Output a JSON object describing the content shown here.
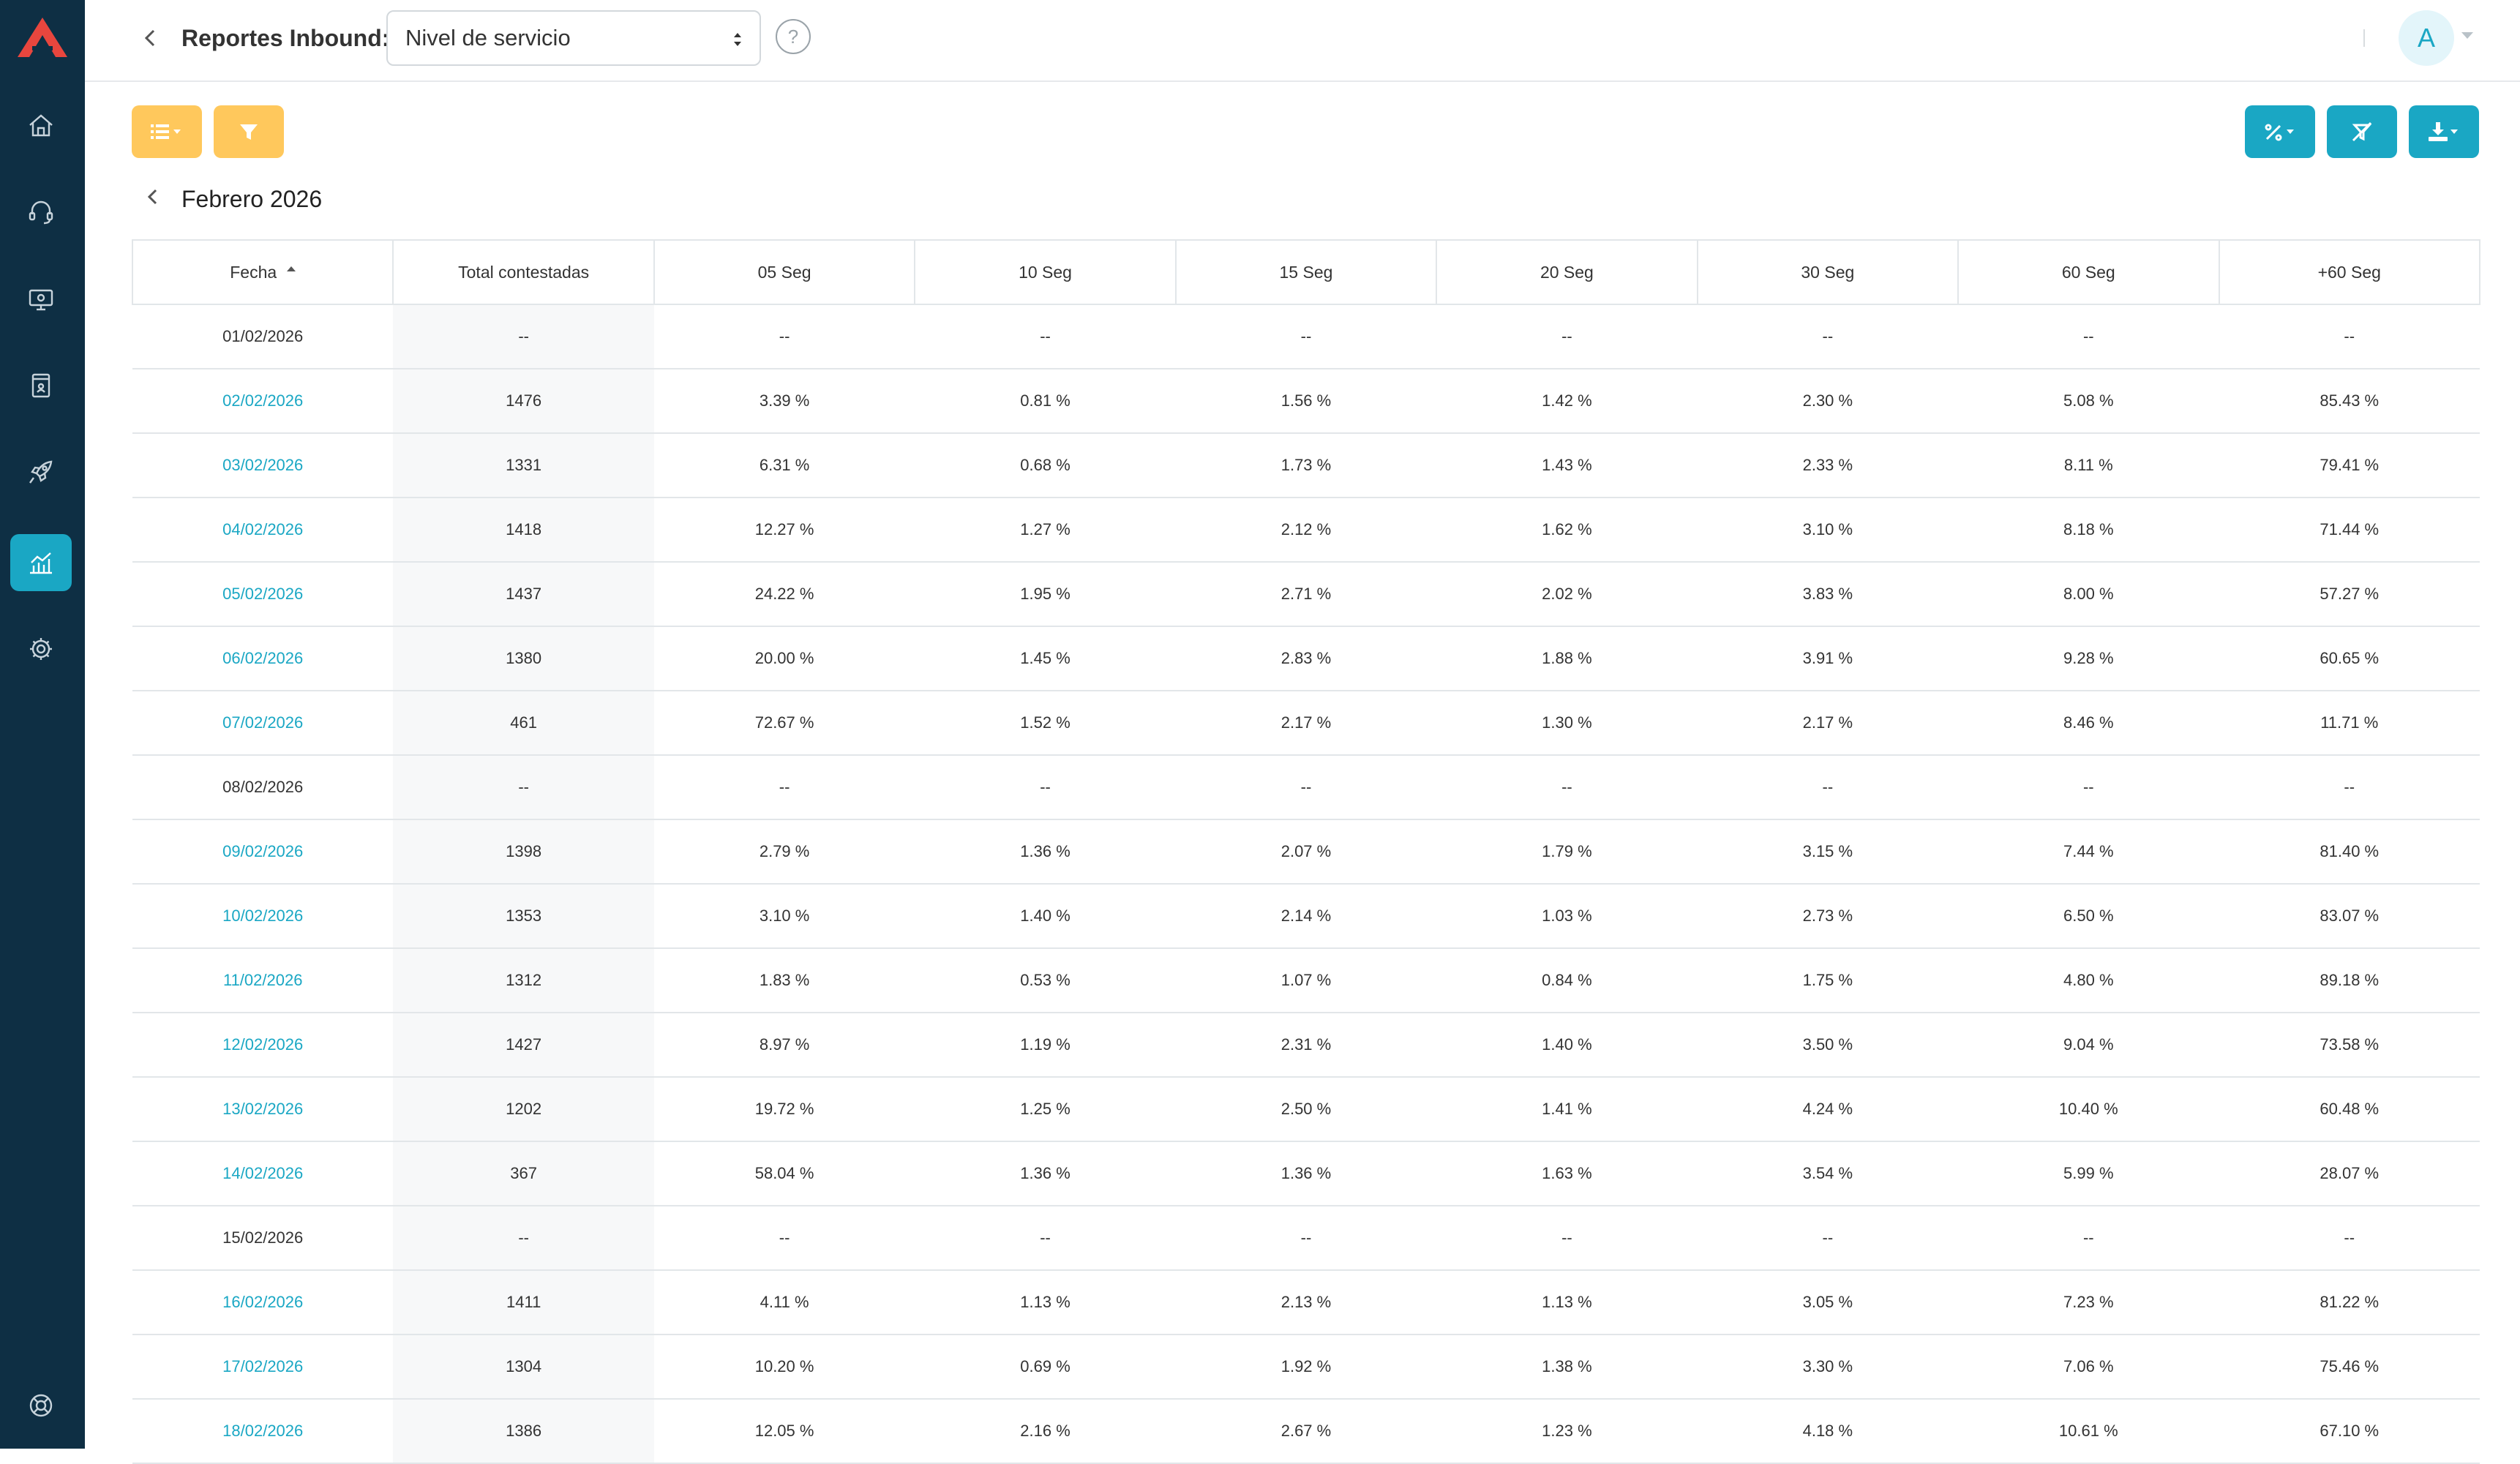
{
  "header": {
    "title": "Reportes Inbound:",
    "report_select": "Nivel de servicio",
    "help": "?",
    "avatar_initial": "A"
  },
  "period": {
    "label": "Febrero 2026"
  },
  "colors": {
    "sidebar": "#0e2f44",
    "accent": "#1aa7c4",
    "warning": "#ffc85c",
    "logo": "#e8463e"
  },
  "sidebar": {
    "items": [
      {
        "icon": "home-icon"
      },
      {
        "icon": "headset-icon"
      },
      {
        "icon": "monitor-icon"
      },
      {
        "icon": "contacts-book-icon"
      },
      {
        "icon": "rocket-icon"
      },
      {
        "icon": "reports-chart-icon",
        "active": true
      },
      {
        "icon": "gear-icon"
      },
      {
        "icon": "support-lifebuoy-icon"
      }
    ]
  },
  "table": {
    "columns": [
      "Fecha",
      "Total contestadas",
      "05 Seg",
      "10 Seg",
      "15 Seg",
      "20 Seg",
      "30 Seg",
      "60 Seg",
      "+60 Seg"
    ],
    "rows": [
      {
        "fecha": "01/02/2026",
        "link": false,
        "total": "--",
        "s05": "--",
        "s10": "--",
        "s15": "--",
        "s20": "--",
        "s30": "--",
        "s60": "--",
        "s60p": "--"
      },
      {
        "fecha": "02/02/2026",
        "link": true,
        "total": "1476",
        "s05": "3.39 %",
        "s10": "0.81 %",
        "s15": "1.56 %",
        "s20": "1.42 %",
        "s30": "2.30 %",
        "s60": "5.08 %",
        "s60p": "85.43 %"
      },
      {
        "fecha": "03/02/2026",
        "link": true,
        "total": "1331",
        "s05": "6.31 %",
        "s10": "0.68 %",
        "s15": "1.73 %",
        "s20": "1.43 %",
        "s30": "2.33 %",
        "s60": "8.11 %",
        "s60p": "79.41 %"
      },
      {
        "fecha": "04/02/2026",
        "link": true,
        "total": "1418",
        "s05": "12.27 %",
        "s10": "1.27 %",
        "s15": "2.12 %",
        "s20": "1.62 %",
        "s30": "3.10 %",
        "s60": "8.18 %",
        "s60p": "71.44 %"
      },
      {
        "fecha": "05/02/2026",
        "link": true,
        "total": "1437",
        "s05": "24.22 %",
        "s10": "1.95 %",
        "s15": "2.71 %",
        "s20": "2.02 %",
        "s30": "3.83 %",
        "s60": "8.00 %",
        "s60p": "57.27 %"
      },
      {
        "fecha": "06/02/2026",
        "link": true,
        "total": "1380",
        "s05": "20.00 %",
        "s10": "1.45 %",
        "s15": "2.83 %",
        "s20": "1.88 %",
        "s30": "3.91 %",
        "s60": "9.28 %",
        "s60p": "60.65 %"
      },
      {
        "fecha": "07/02/2026",
        "link": true,
        "total": "461",
        "s05": "72.67 %",
        "s10": "1.52 %",
        "s15": "2.17 %",
        "s20": "1.30 %",
        "s30": "2.17 %",
        "s60": "8.46 %",
        "s60p": "11.71 %"
      },
      {
        "fecha": "08/02/2026",
        "link": false,
        "total": "--",
        "s05": "--",
        "s10": "--",
        "s15": "--",
        "s20": "--",
        "s30": "--",
        "s60": "--",
        "s60p": "--"
      },
      {
        "fecha": "09/02/2026",
        "link": true,
        "total": "1398",
        "s05": "2.79 %",
        "s10": "1.36 %",
        "s15": "2.07 %",
        "s20": "1.79 %",
        "s30": "3.15 %",
        "s60": "7.44 %",
        "s60p": "81.40 %"
      },
      {
        "fecha": "10/02/2026",
        "link": true,
        "total": "1353",
        "s05": "3.10 %",
        "s10": "1.40 %",
        "s15": "2.14 %",
        "s20": "1.03 %",
        "s30": "2.73 %",
        "s60": "6.50 %",
        "s60p": "83.07 %"
      },
      {
        "fecha": "11/02/2026",
        "link": true,
        "total": "1312",
        "s05": "1.83 %",
        "s10": "0.53 %",
        "s15": "1.07 %",
        "s20": "0.84 %",
        "s30": "1.75 %",
        "s60": "4.80 %",
        "s60p": "89.18 %"
      },
      {
        "fecha": "12/02/2026",
        "link": true,
        "total": "1427",
        "s05": "8.97 %",
        "s10": "1.19 %",
        "s15": "2.31 %",
        "s20": "1.40 %",
        "s30": "3.50 %",
        "s60": "9.04 %",
        "s60p": "73.58 %"
      },
      {
        "fecha": "13/02/2026",
        "link": true,
        "total": "1202",
        "s05": "19.72 %",
        "s10": "1.25 %",
        "s15": "2.50 %",
        "s20": "1.41 %",
        "s30": "4.24 %",
        "s60": "10.40 %",
        "s60p": "60.48 %"
      },
      {
        "fecha": "14/02/2026",
        "link": true,
        "total": "367",
        "s05": "58.04 %",
        "s10": "1.36 %",
        "s15": "1.36 %",
        "s20": "1.63 %",
        "s30": "3.54 %",
        "s60": "5.99 %",
        "s60p": "28.07 %"
      },
      {
        "fecha": "15/02/2026",
        "link": false,
        "total": "--",
        "s05": "--",
        "s10": "--",
        "s15": "--",
        "s20": "--",
        "s30": "--",
        "s60": "--",
        "s60p": "--"
      },
      {
        "fecha": "16/02/2026",
        "link": true,
        "total": "1411",
        "s05": "4.11 %",
        "s10": "1.13 %",
        "s15": "2.13 %",
        "s20": "1.13 %",
        "s30": "3.05 %",
        "s60": "7.23 %",
        "s60p": "81.22 %"
      },
      {
        "fecha": "17/02/2026",
        "link": true,
        "total": "1304",
        "s05": "10.20 %",
        "s10": "0.69 %",
        "s15": "1.92 %",
        "s20": "1.38 %",
        "s30": "3.30 %",
        "s60": "7.06 %",
        "s60p": "75.46 %"
      },
      {
        "fecha": "18/02/2026",
        "link": true,
        "total": "1386",
        "s05": "12.05 %",
        "s10": "2.16 %",
        "s15": "2.67 %",
        "s20": "1.23 %",
        "s30": "4.18 %",
        "s60": "10.61 %",
        "s60p": "67.10 %"
      }
    ]
  }
}
